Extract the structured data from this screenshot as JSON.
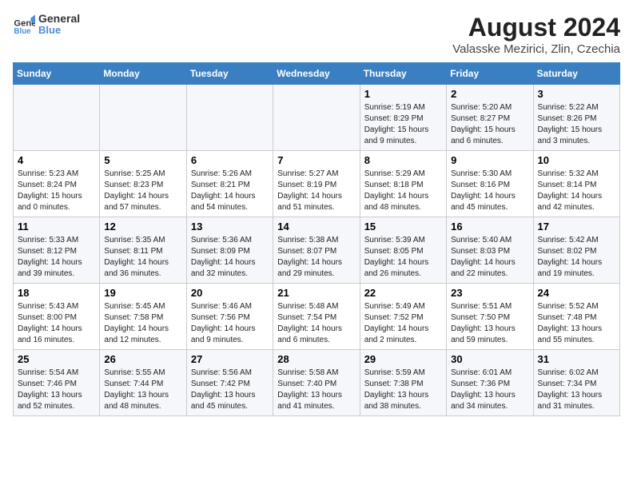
{
  "header": {
    "logo_line1": "General",
    "logo_line2": "Blue",
    "title": "August 2024",
    "subtitle": "Valasske Mezirici, Zlin, Czechia"
  },
  "days_of_week": [
    "Sunday",
    "Monday",
    "Tuesday",
    "Wednesday",
    "Thursday",
    "Friday",
    "Saturday"
  ],
  "weeks": [
    [
      {
        "day": "",
        "info": ""
      },
      {
        "day": "",
        "info": ""
      },
      {
        "day": "",
        "info": ""
      },
      {
        "day": "",
        "info": ""
      },
      {
        "day": "1",
        "info": "Sunrise: 5:19 AM\nSunset: 8:29 PM\nDaylight: 15 hours\nand 9 minutes."
      },
      {
        "day": "2",
        "info": "Sunrise: 5:20 AM\nSunset: 8:27 PM\nDaylight: 15 hours\nand 6 minutes."
      },
      {
        "day": "3",
        "info": "Sunrise: 5:22 AM\nSunset: 8:26 PM\nDaylight: 15 hours\nand 3 minutes."
      }
    ],
    [
      {
        "day": "4",
        "info": "Sunrise: 5:23 AM\nSunset: 8:24 PM\nDaylight: 15 hours\nand 0 minutes."
      },
      {
        "day": "5",
        "info": "Sunrise: 5:25 AM\nSunset: 8:23 PM\nDaylight: 14 hours\nand 57 minutes."
      },
      {
        "day": "6",
        "info": "Sunrise: 5:26 AM\nSunset: 8:21 PM\nDaylight: 14 hours\nand 54 minutes."
      },
      {
        "day": "7",
        "info": "Sunrise: 5:27 AM\nSunset: 8:19 PM\nDaylight: 14 hours\nand 51 minutes."
      },
      {
        "day": "8",
        "info": "Sunrise: 5:29 AM\nSunset: 8:18 PM\nDaylight: 14 hours\nand 48 minutes."
      },
      {
        "day": "9",
        "info": "Sunrise: 5:30 AM\nSunset: 8:16 PM\nDaylight: 14 hours\nand 45 minutes."
      },
      {
        "day": "10",
        "info": "Sunrise: 5:32 AM\nSunset: 8:14 PM\nDaylight: 14 hours\nand 42 minutes."
      }
    ],
    [
      {
        "day": "11",
        "info": "Sunrise: 5:33 AM\nSunset: 8:12 PM\nDaylight: 14 hours\nand 39 minutes."
      },
      {
        "day": "12",
        "info": "Sunrise: 5:35 AM\nSunset: 8:11 PM\nDaylight: 14 hours\nand 36 minutes."
      },
      {
        "day": "13",
        "info": "Sunrise: 5:36 AM\nSunset: 8:09 PM\nDaylight: 14 hours\nand 32 minutes."
      },
      {
        "day": "14",
        "info": "Sunrise: 5:38 AM\nSunset: 8:07 PM\nDaylight: 14 hours\nand 29 minutes."
      },
      {
        "day": "15",
        "info": "Sunrise: 5:39 AM\nSunset: 8:05 PM\nDaylight: 14 hours\nand 26 minutes."
      },
      {
        "day": "16",
        "info": "Sunrise: 5:40 AM\nSunset: 8:03 PM\nDaylight: 14 hours\nand 22 minutes."
      },
      {
        "day": "17",
        "info": "Sunrise: 5:42 AM\nSunset: 8:02 PM\nDaylight: 14 hours\nand 19 minutes."
      }
    ],
    [
      {
        "day": "18",
        "info": "Sunrise: 5:43 AM\nSunset: 8:00 PM\nDaylight: 14 hours\nand 16 minutes."
      },
      {
        "day": "19",
        "info": "Sunrise: 5:45 AM\nSunset: 7:58 PM\nDaylight: 14 hours\nand 12 minutes."
      },
      {
        "day": "20",
        "info": "Sunrise: 5:46 AM\nSunset: 7:56 PM\nDaylight: 14 hours\nand 9 minutes."
      },
      {
        "day": "21",
        "info": "Sunrise: 5:48 AM\nSunset: 7:54 PM\nDaylight: 14 hours\nand 6 minutes."
      },
      {
        "day": "22",
        "info": "Sunrise: 5:49 AM\nSunset: 7:52 PM\nDaylight: 14 hours\nand 2 minutes."
      },
      {
        "day": "23",
        "info": "Sunrise: 5:51 AM\nSunset: 7:50 PM\nDaylight: 13 hours\nand 59 minutes."
      },
      {
        "day": "24",
        "info": "Sunrise: 5:52 AM\nSunset: 7:48 PM\nDaylight: 13 hours\nand 55 minutes."
      }
    ],
    [
      {
        "day": "25",
        "info": "Sunrise: 5:54 AM\nSunset: 7:46 PM\nDaylight: 13 hours\nand 52 minutes."
      },
      {
        "day": "26",
        "info": "Sunrise: 5:55 AM\nSunset: 7:44 PM\nDaylight: 13 hours\nand 48 minutes."
      },
      {
        "day": "27",
        "info": "Sunrise: 5:56 AM\nSunset: 7:42 PM\nDaylight: 13 hours\nand 45 minutes."
      },
      {
        "day": "28",
        "info": "Sunrise: 5:58 AM\nSunset: 7:40 PM\nDaylight: 13 hours\nand 41 minutes."
      },
      {
        "day": "29",
        "info": "Sunrise: 5:59 AM\nSunset: 7:38 PM\nDaylight: 13 hours\nand 38 minutes."
      },
      {
        "day": "30",
        "info": "Sunrise: 6:01 AM\nSunset: 7:36 PM\nDaylight: 13 hours\nand 34 minutes."
      },
      {
        "day": "31",
        "info": "Sunrise: 6:02 AM\nSunset: 7:34 PM\nDaylight: 13 hours\nand 31 minutes."
      }
    ]
  ]
}
